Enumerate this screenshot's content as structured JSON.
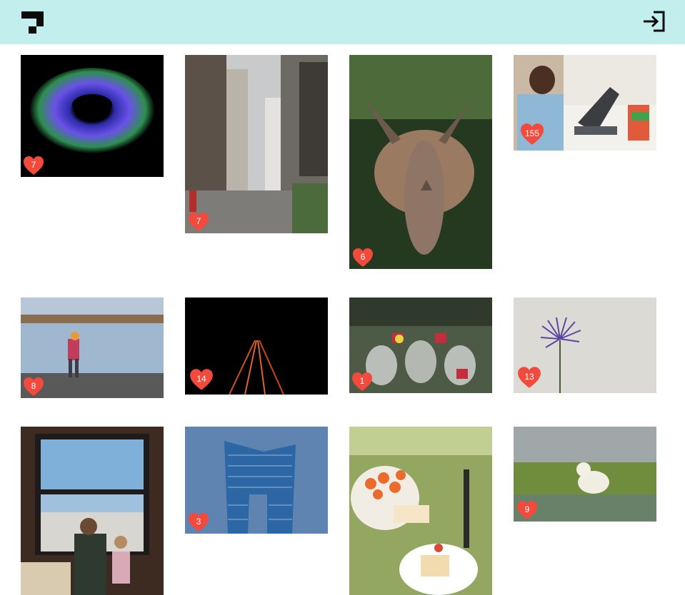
{
  "header": {
    "logo_icon": "brand-logo",
    "login_icon": "login-icon",
    "background": "#c2eeee"
  },
  "photos": [
    {
      "name": "abstract-blue-swirl",
      "likes": "7"
    },
    {
      "name": "city-street",
      "likes": "7"
    },
    {
      "name": "triceratops-sculpture",
      "likes": "6"
    },
    {
      "name": "video-call-laptop",
      "likes": "155"
    },
    {
      "name": "hiker-by-lake",
      "likes": "8"
    },
    {
      "name": "highway-light-trails",
      "likes": "14"
    },
    {
      "name": "shrine-statues",
      "likes": "1"
    },
    {
      "name": "purple-flower",
      "likes": "13"
    },
    {
      "name": "window-view-family",
      "likes": ""
    },
    {
      "name": "blue-building",
      "likes": "3"
    },
    {
      "name": "fruit-cake-picnic",
      "likes": ""
    },
    {
      "name": "polar-bear",
      "likes": "9"
    }
  ],
  "colors": {
    "heart": "#f24a3d",
    "like_text": "#ffffff"
  }
}
